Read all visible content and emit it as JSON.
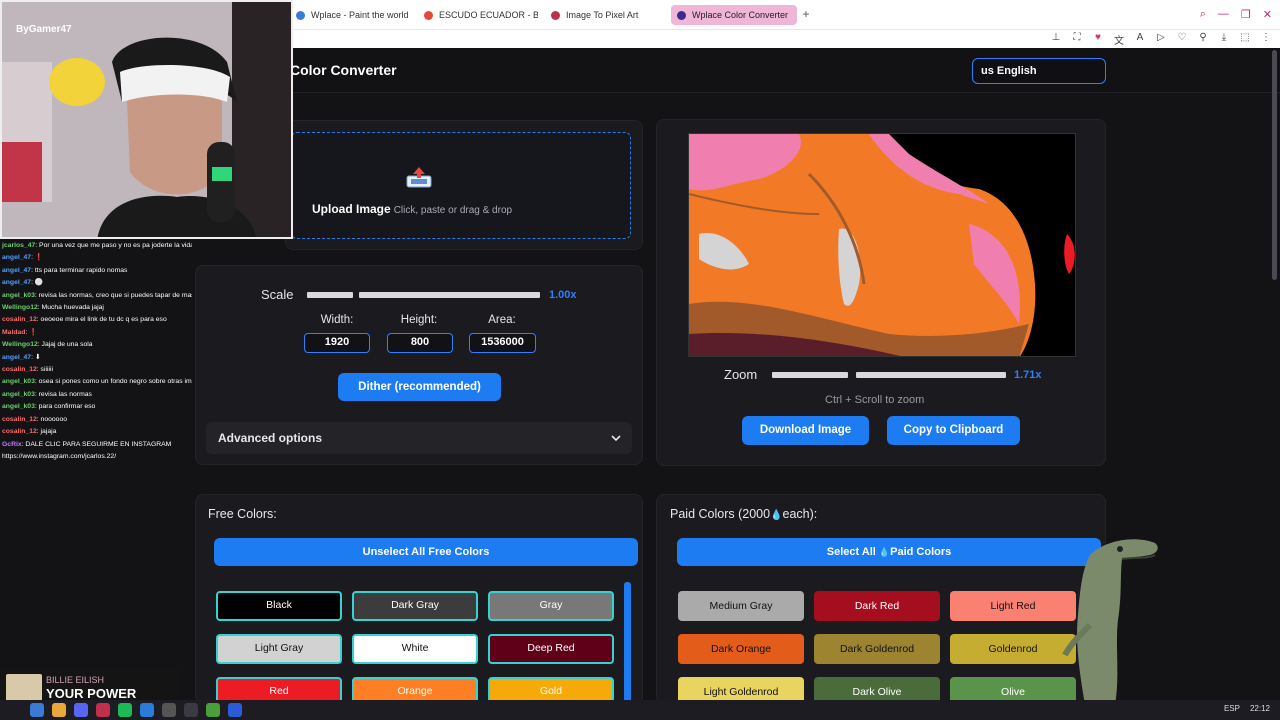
{
  "browser": {
    "tabs": [
      {
        "label": "Wplace - Paint the world",
        "color": "#3b7bd8"
      },
      {
        "label": "ESCUDO ECUADOR - Bu",
        "color": "#e8463a"
      },
      {
        "label": "Image To Pixel Art",
        "color": "#c0304a"
      },
      {
        "label": "Wplace Color Converter",
        "color": "#3a2a8c"
      }
    ],
    "new_tab": "+"
  },
  "header": {
    "title": "Color Converter",
    "language": "us English"
  },
  "upload": {
    "label": "Upload Image",
    "hint": "Click, paste or drag & drop"
  },
  "scale": {
    "label": "Scale",
    "value": "1.00x"
  },
  "dimensions": {
    "width_label": "Width:",
    "width": "1920",
    "height_label": "Height:",
    "height": "800",
    "area_label": "Area:",
    "area": "1536000"
  },
  "dither_button": "Dither (recommended)",
  "advanced": {
    "label": "Advanced options"
  },
  "zoom": {
    "label": "Zoom",
    "value": "1.71x",
    "hint": "Ctrl + Scroll to zoom"
  },
  "actions": {
    "download": "Download Image",
    "copy": "Copy to Clipboard"
  },
  "free_colors": {
    "title": "Free Colors:",
    "button": "Unselect All Free Colors",
    "swatches": [
      {
        "name": "Black",
        "bg": "#000000",
        "fg": "#ffffff"
      },
      {
        "name": "Dark Gray",
        "bg": "#3c3c3c",
        "fg": "#ffffff"
      },
      {
        "name": "Gray",
        "bg": "#787878",
        "fg": "#ffffff"
      },
      {
        "name": "Light Gray",
        "bg": "#d2d2d2",
        "fg": "#111111"
      },
      {
        "name": "White",
        "bg": "#ffffff",
        "fg": "#111111"
      },
      {
        "name": "Deep Red",
        "bg": "#600018",
        "fg": "#ffffff"
      },
      {
        "name": "Red",
        "bg": "#ed1c24",
        "fg": "#ffffff"
      },
      {
        "name": "Orange",
        "bg": "#ff7f27",
        "fg": "#ffffff"
      },
      {
        "name": "Gold",
        "bg": "#f6aa09",
        "fg": "#ffffff"
      }
    ]
  },
  "paid_colors": {
    "title_prefix": "Paid Colors (2000",
    "title_suffix": "each):",
    "button_prefix": "Select All",
    "button_suffix": "Paid Colors",
    "swatches": [
      {
        "name": "Medium Gray",
        "bg": "#aaaaaa",
        "fg": "#111111"
      },
      {
        "name": "Dark Red",
        "bg": "#a50e1e",
        "fg": "#ffffff"
      },
      {
        "name": "Light Red",
        "bg": "#fa8072",
        "fg": "#111111"
      },
      {
        "name": "Dark Orange",
        "bg": "#e45c1a",
        "fg": "#111111"
      },
      {
        "name": "Dark Goldenrod",
        "bg": "#9c8431",
        "fg": "#111111"
      },
      {
        "name": "Goldenrod",
        "bg": "#c5ad31",
        "fg": "#111111"
      },
      {
        "name": "Light Goldenrod",
        "bg": "#e8d45f",
        "fg": "#111111"
      },
      {
        "name": "Dark Olive",
        "bg": "#4a6b3a",
        "fg": "#ffffff"
      },
      {
        "name": "Olive",
        "bg": "#5a944a",
        "fg": "#ffffff"
      }
    ]
  },
  "stream": {
    "channel": "ByGamer47",
    "chat": [
      {
        "user": "jcarlos_47",
        "msg": ": Por una vez que me paso y no es pa joderte la vida",
        "c": ""
      },
      {
        "user": "angel_47",
        "msg": ": ❗",
        "c": "c2"
      },
      {
        "user": "angel_47",
        "msg": ": tts para terminar rapido nomas",
        "c": "c2"
      },
      {
        "user": "angel_47",
        "msg": ": ⚪",
        "c": "c2"
      },
      {
        "user": "angel_k03",
        "msg": ": revisa las normas, creo que si puedes tapar de mas no pasa nada",
        "c": ""
      },
      {
        "user": "Wellingo12",
        "msg": ": Mucha huevada jajaj",
        "c": ""
      },
      {
        "user": "cosalin_12",
        "msg": ": oeoeoe mira el link de tu dc q es para eso",
        "c": "c3"
      },
      {
        "user": "Maldad",
        "msg": ": ❗",
        "c": "c3"
      },
      {
        "user": "Wellingo12",
        "msg": ": Jajaj de una sola",
        "c": ""
      },
      {
        "user": "angel_47",
        "msg": ": ⬇",
        "c": "c2"
      },
      {
        "user": "cosalin_12",
        "msg": ": siiiiii",
        "c": "c3"
      },
      {
        "user": "angel_k03",
        "msg": ": osea si pones como un fondo negro sobre otras imagenes no pasa nada",
        "c": ""
      },
      {
        "user": "angel_k03",
        "msg": ": revisa las normas",
        "c": ""
      },
      {
        "user": "angel_k03",
        "msg": ": para confirmar eso",
        "c": ""
      },
      {
        "user": "cosalin_12",
        "msg": ": noooooo",
        "c": "c3"
      },
      {
        "user": "cosalin_12",
        "msg": ": jajaja",
        "c": "c3"
      },
      {
        "user": "GcRix",
        "msg": ": DALE CLIC PARA SEGUIRME EN INSTAGRAM",
        "c": "c4"
      },
      {
        "user": "",
        "msg": "https://www.instagram.com/jcarlos.22/",
        "c": ""
      }
    ],
    "now_playing": {
      "artist": "BILLIE EILISH",
      "song": "YOUR POWER"
    }
  },
  "taskbar": {
    "lang": "ESP",
    "time": "22:12"
  }
}
